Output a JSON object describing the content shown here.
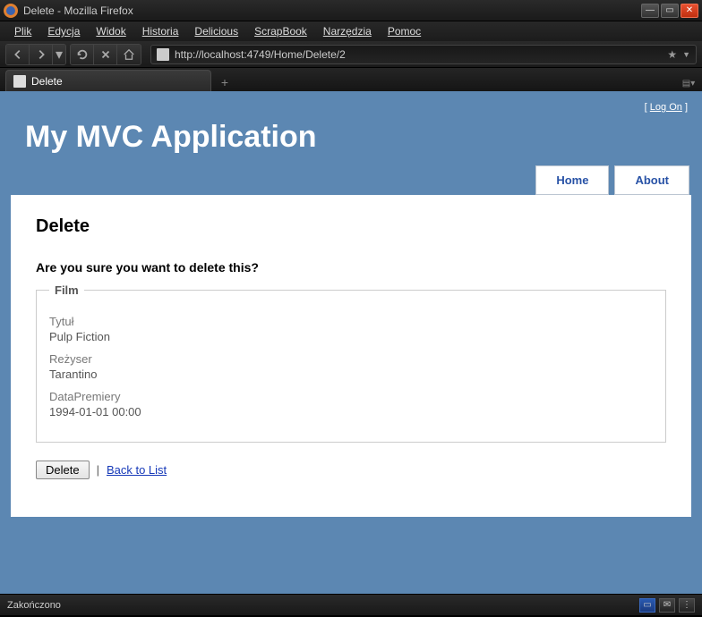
{
  "window": {
    "title": "Delete - Mozilla Firefox"
  },
  "menubar": [
    "Plik",
    "Edycja",
    "Widok",
    "Historia",
    "Delicious",
    "ScrapBook",
    "Narzędzia",
    "Pomoc"
  ],
  "url": "http://localhost:4749/Home/Delete/2",
  "tab": {
    "title": "Delete"
  },
  "login": {
    "open": "[",
    "label": "Log On",
    "close": "]"
  },
  "apptitle": "My MVC Application",
  "nav": {
    "home": "Home",
    "about": "About"
  },
  "page": {
    "heading": "Delete",
    "confirm": "Are you sure you want to delete this?",
    "legend": "Film",
    "fields": {
      "title_label": "Tytuł",
      "title_value": "Pulp Fiction",
      "director_label": "Reżyser",
      "director_value": "Tarantino",
      "date_label": "DataPremiery",
      "date_value": "1994-01-01 00:00"
    },
    "deletebtn": "Delete",
    "sep": "|",
    "back": "Back to List"
  },
  "status": "Zakończono"
}
